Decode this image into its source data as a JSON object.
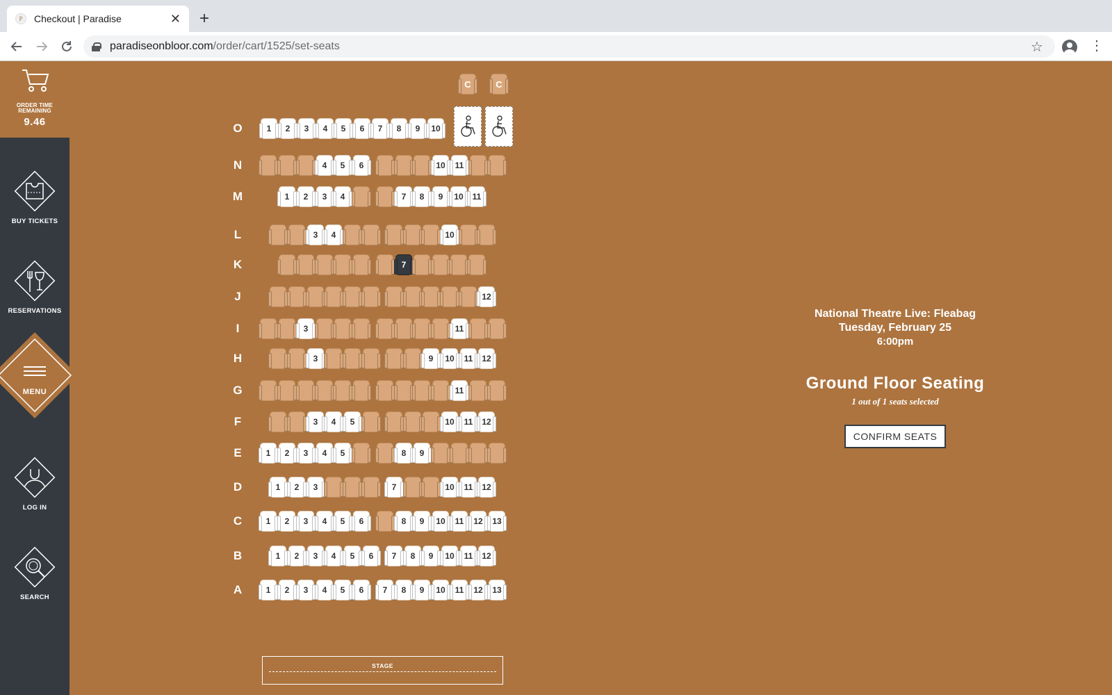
{
  "browser": {
    "tab_title": "Checkout | Paradise",
    "favicon_letter": "P",
    "close_symbol": "✕",
    "new_tab_symbol": "+",
    "url_host": "paradiseonbloor.com",
    "url_path": "/order/cart/1525/set-seats",
    "icons": [
      "back-arrow-icon",
      "forward-arrow-icon",
      "reload-icon",
      "lock-icon",
      "star-icon",
      "profile-icon",
      "kebab-icon"
    ]
  },
  "sidebar": {
    "timer_label": "ORDER TIME\nREMAINING",
    "timer_value": "9.46",
    "items": [
      {
        "label": "BUY TICKETS",
        "icon": "ticket-icon"
      },
      {
        "label": "RESERVATIONS",
        "icon": "fork-wine-icon"
      },
      {
        "label": "MENU",
        "icon": "hamburger-icon"
      },
      {
        "label": "LOG IN",
        "icon": "user-icon"
      },
      {
        "label": "SEARCH",
        "icon": "search-icon"
      }
    ],
    "colors": {
      "sidebar_bg": "#343a40",
      "accent": "#ad743f"
    }
  },
  "seatmap": {
    "colors": {
      "available": "#ffffff",
      "taken": "#d9a77b",
      "selected": "#343a40"
    },
    "companion_label": "C",
    "rows": [
      {
        "label": "O",
        "seats": [
          {
            "n": "1",
            "s": "a"
          },
          {
            "n": "2",
            "s": "a"
          },
          {
            "n": "3",
            "s": "a"
          },
          {
            "n": "4",
            "s": "a"
          },
          {
            "n": "5",
            "s": "a"
          },
          {
            "n": "6",
            "s": "a"
          },
          {
            "n": "7",
            "s": "a"
          },
          {
            "n": "8",
            "s": "a"
          },
          {
            "n": "9",
            "s": "a"
          },
          {
            "n": "10",
            "s": "a"
          }
        ],
        "wheelchair": 2
      },
      {
        "label": "N",
        "seats": [
          {
            "n": "",
            "s": "t"
          },
          {
            "n": "",
            "s": "t"
          },
          {
            "n": "",
            "s": "t"
          },
          {
            "n": "4",
            "s": "a"
          },
          {
            "n": "5",
            "s": "a"
          },
          {
            "n": "6",
            "s": "a"
          },
          {
            "n": "",
            "s": "t"
          },
          {
            "n": "",
            "s": "t"
          },
          {
            "n": "",
            "s": "t"
          },
          {
            "n": "10",
            "s": "a"
          },
          {
            "n": "11",
            "s": "a"
          },
          {
            "n": "",
            "s": "t"
          },
          {
            "n": "",
            "s": "t"
          }
        ]
      },
      {
        "label": "M",
        "seats": [
          {
            "n": "1",
            "s": "a"
          },
          {
            "n": "2",
            "s": "a"
          },
          {
            "n": "3",
            "s": "a"
          },
          {
            "n": "4",
            "s": "a"
          },
          {
            "n": "",
            "s": "t"
          },
          {
            "n": "",
            "s": "t"
          },
          {
            "n": "7",
            "s": "a"
          },
          {
            "n": "8",
            "s": "a"
          },
          {
            "n": "9",
            "s": "a"
          },
          {
            "n": "10",
            "s": "a"
          },
          {
            "n": "11",
            "s": "a"
          }
        ]
      },
      {
        "label": "L",
        "seats": [
          {
            "n": "",
            "s": "t"
          },
          {
            "n": "",
            "s": "t"
          },
          {
            "n": "3",
            "s": "a"
          },
          {
            "n": "4",
            "s": "a"
          },
          {
            "n": "",
            "s": "t"
          },
          {
            "n": "",
            "s": "t"
          },
          {
            "n": "",
            "s": "t"
          },
          {
            "n": "",
            "s": "t"
          },
          {
            "n": "",
            "s": "t"
          },
          {
            "n": "10",
            "s": "a"
          },
          {
            "n": "",
            "s": "t"
          },
          {
            "n": "",
            "s": "t"
          }
        ]
      },
      {
        "label": "K",
        "seats": [
          {
            "n": "",
            "s": "t"
          },
          {
            "n": "",
            "s": "t"
          },
          {
            "n": "",
            "s": "t"
          },
          {
            "n": "",
            "s": "t"
          },
          {
            "n": "",
            "s": "t"
          },
          {
            "n": "",
            "s": "t"
          },
          {
            "n": "7",
            "s": "s"
          },
          {
            "n": "",
            "s": "t"
          },
          {
            "n": "",
            "s": "t"
          },
          {
            "n": "",
            "s": "t"
          },
          {
            "n": "",
            "s": "t"
          }
        ]
      },
      {
        "label": "J",
        "seats": [
          {
            "n": "",
            "s": "t"
          },
          {
            "n": "",
            "s": "t"
          },
          {
            "n": "",
            "s": "t"
          },
          {
            "n": "",
            "s": "t"
          },
          {
            "n": "",
            "s": "t"
          },
          {
            "n": "",
            "s": "t"
          },
          {
            "n": "",
            "s": "t"
          },
          {
            "n": "",
            "s": "t"
          },
          {
            "n": "",
            "s": "t"
          },
          {
            "n": "",
            "s": "t"
          },
          {
            "n": "",
            "s": "t"
          },
          {
            "n": "12",
            "s": "a"
          }
        ]
      },
      {
        "label": "I",
        "seats": [
          {
            "n": "",
            "s": "t"
          },
          {
            "n": "",
            "s": "t"
          },
          {
            "n": "3",
            "s": "a"
          },
          {
            "n": "",
            "s": "t"
          },
          {
            "n": "",
            "s": "t"
          },
          {
            "n": "",
            "s": "t"
          },
          {
            "n": "",
            "s": "t"
          },
          {
            "n": "",
            "s": "t"
          },
          {
            "n": "",
            "s": "t"
          },
          {
            "n": "",
            "s": "t"
          },
          {
            "n": "11",
            "s": "a"
          },
          {
            "n": "",
            "s": "t"
          },
          {
            "n": "",
            "s": "t"
          }
        ]
      },
      {
        "label": "H",
        "seats": [
          {
            "n": "",
            "s": "t"
          },
          {
            "n": "",
            "s": "t"
          },
          {
            "n": "3",
            "s": "a"
          },
          {
            "n": "",
            "s": "t"
          },
          {
            "n": "",
            "s": "t"
          },
          {
            "n": "",
            "s": "t"
          },
          {
            "n": "",
            "s": "t"
          },
          {
            "n": "",
            "s": "t"
          },
          {
            "n": "9",
            "s": "a"
          },
          {
            "n": "10",
            "s": "a"
          },
          {
            "n": "11",
            "s": "a"
          },
          {
            "n": "12",
            "s": "a"
          }
        ]
      },
      {
        "label": "G",
        "seats": [
          {
            "n": "",
            "s": "t"
          },
          {
            "n": "",
            "s": "t"
          },
          {
            "n": "",
            "s": "t"
          },
          {
            "n": "",
            "s": "t"
          },
          {
            "n": "",
            "s": "t"
          },
          {
            "n": "",
            "s": "t"
          },
          {
            "n": "",
            "s": "t"
          },
          {
            "n": "",
            "s": "t"
          },
          {
            "n": "",
            "s": "t"
          },
          {
            "n": "",
            "s": "t"
          },
          {
            "n": "11",
            "s": "a"
          },
          {
            "n": "",
            "s": "t"
          },
          {
            "n": "",
            "s": "t"
          }
        ]
      },
      {
        "label": "F",
        "seats": [
          {
            "n": "",
            "s": "t"
          },
          {
            "n": "",
            "s": "t"
          },
          {
            "n": "3",
            "s": "a"
          },
          {
            "n": "4",
            "s": "a"
          },
          {
            "n": "5",
            "s": "a"
          },
          {
            "n": "",
            "s": "t"
          },
          {
            "n": "",
            "s": "t"
          },
          {
            "n": "",
            "s": "t"
          },
          {
            "n": "",
            "s": "t"
          },
          {
            "n": "10",
            "s": "a"
          },
          {
            "n": "11",
            "s": "a"
          },
          {
            "n": "12",
            "s": "a"
          }
        ]
      },
      {
        "label": "E",
        "seats": [
          {
            "n": "1",
            "s": "a"
          },
          {
            "n": "2",
            "s": "a"
          },
          {
            "n": "3",
            "s": "a"
          },
          {
            "n": "4",
            "s": "a"
          },
          {
            "n": "5",
            "s": "a"
          },
          {
            "n": "",
            "s": "t"
          },
          {
            "n": "",
            "s": "t"
          },
          {
            "n": "8",
            "s": "a"
          },
          {
            "n": "9",
            "s": "a"
          },
          {
            "n": "",
            "s": "t"
          },
          {
            "n": "",
            "s": "t"
          },
          {
            "n": "",
            "s": "t"
          },
          {
            "n": "",
            "s": "t"
          }
        ]
      },
      {
        "label": "D",
        "seats": [
          {
            "n": "1",
            "s": "a"
          },
          {
            "n": "2",
            "s": "a"
          },
          {
            "n": "3",
            "s": "a"
          },
          {
            "n": "",
            "s": "t"
          },
          {
            "n": "",
            "s": "t"
          },
          {
            "n": "",
            "s": "t"
          },
          {
            "n": "7",
            "s": "a"
          },
          {
            "n": "",
            "s": "t"
          },
          {
            "n": "",
            "s": "t"
          },
          {
            "n": "10",
            "s": "a"
          },
          {
            "n": "11",
            "s": "a"
          },
          {
            "n": "12",
            "s": "a"
          }
        ]
      },
      {
        "label": "C",
        "seats": [
          {
            "n": "1",
            "s": "a"
          },
          {
            "n": "2",
            "s": "a"
          },
          {
            "n": "3",
            "s": "a"
          },
          {
            "n": "4",
            "s": "a"
          },
          {
            "n": "5",
            "s": "a"
          },
          {
            "n": "6",
            "s": "a"
          },
          {
            "n": "",
            "s": "t"
          },
          {
            "n": "8",
            "s": "a"
          },
          {
            "n": "9",
            "s": "a"
          },
          {
            "n": "10",
            "s": "a"
          },
          {
            "n": "11",
            "s": "a"
          },
          {
            "n": "12",
            "s": "a"
          },
          {
            "n": "13",
            "s": "a"
          }
        ]
      },
      {
        "label": "B",
        "seats": [
          {
            "n": "1",
            "s": "a"
          },
          {
            "n": "2",
            "s": "a"
          },
          {
            "n": "3",
            "s": "a"
          },
          {
            "n": "4",
            "s": "a"
          },
          {
            "n": "5",
            "s": "a"
          },
          {
            "n": "6",
            "s": "a"
          },
          {
            "n": "7",
            "s": "a"
          },
          {
            "n": "8",
            "s": "a"
          },
          {
            "n": "9",
            "s": "a"
          },
          {
            "n": "10",
            "s": "a"
          },
          {
            "n": "11",
            "s": "a"
          },
          {
            "n": "12",
            "s": "a"
          }
        ]
      },
      {
        "label": "A",
        "seats": [
          {
            "n": "1",
            "s": "a"
          },
          {
            "n": "2",
            "s": "a"
          },
          {
            "n": "3",
            "s": "a"
          },
          {
            "n": "4",
            "s": "a"
          },
          {
            "n": "5",
            "s": "a"
          },
          {
            "n": "6",
            "s": "a"
          },
          {
            "n": "7",
            "s": "a"
          },
          {
            "n": "8",
            "s": "a"
          },
          {
            "n": "9",
            "s": "a"
          },
          {
            "n": "10",
            "s": "a"
          },
          {
            "n": "11",
            "s": "a"
          },
          {
            "n": "12",
            "s": "a"
          },
          {
            "n": "13",
            "s": "a"
          }
        ]
      }
    ],
    "stage_label": "STAGE"
  },
  "info": {
    "show_title": "National Theatre Live: Fleabag",
    "show_date": "Tuesday, February 25",
    "show_time": "6:00pm",
    "section_name": "Ground Floor Seating",
    "seat_count": "1 out of 1 seats selected",
    "confirm_label": "CONFIRM SEATS"
  }
}
